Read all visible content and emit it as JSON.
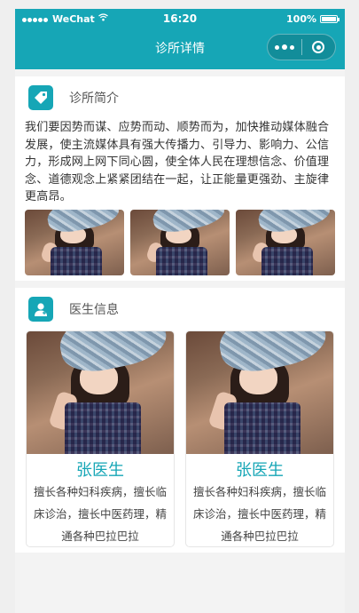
{
  "status_bar": {
    "carrier": "WeChat",
    "time": "16:20",
    "battery": "100%",
    "battery_level": 1.0
  },
  "nav": {
    "title": "诊所详情"
  },
  "intro": {
    "heading": "诊所简介",
    "text": "我们要因势而谋、应势而动、顺势而为，加快推动媒体融合发展，使主流媒体具有强大传播力、引导力、影响力、公信力，形成网上网下同心圆，使全体人民在理想信念、价值理念、道德观念上紧紧团结在一起，让正能量更强劲、主旋律更高昂。"
  },
  "doctors_section": {
    "heading": "医生信息",
    "doctors": [
      {
        "name": "张医生",
        "desc": "擅长各种妇科疾病，擅长临床诊治，擅长中医药理，精通各种巴拉巴拉"
      },
      {
        "name": "张医生",
        "desc": "擅长各种妇科疾病，擅长临床诊治，擅长中医药理，精通各种巴拉巴拉"
      }
    ]
  },
  "colors": {
    "accent": "#16a6b6"
  }
}
